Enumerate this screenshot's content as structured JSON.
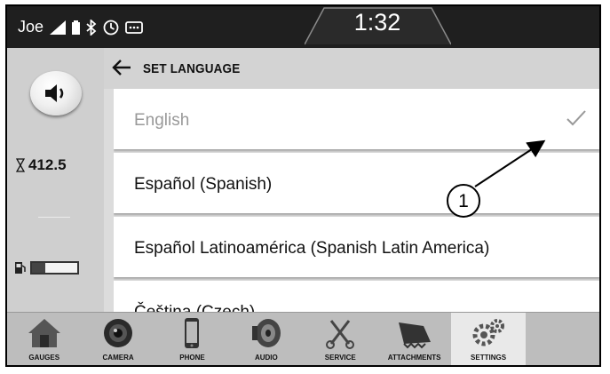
{
  "status_bar": {
    "carrier": "Joe",
    "time": "1:32"
  },
  "side_panel": {
    "hours": "412.5",
    "fuel_level": 0.3
  },
  "header": {
    "title": "SET LANGUAGE"
  },
  "languages": [
    {
      "label": "English",
      "selected": true
    },
    {
      "label": "Español (Spanish)",
      "selected": false
    },
    {
      "label": "Español Latinoamérica (Spanish Latin America)",
      "selected": false
    },
    {
      "label": "Čeština (Czech)",
      "selected": false
    }
  ],
  "callout": {
    "number": "1"
  },
  "bottom_nav": [
    {
      "label": "GAUGES",
      "icon": "house-icon"
    },
    {
      "label": "CAMERA",
      "icon": "camera-icon"
    },
    {
      "label": "PHONE",
      "icon": "phone-icon"
    },
    {
      "label": "AUDIO",
      "icon": "speaker-icon"
    },
    {
      "label": "SERVICE",
      "icon": "wrench-icon"
    },
    {
      "label": "ATTACHMENTS",
      "icon": "bucket-icon"
    },
    {
      "label": "SETTINGS",
      "icon": "gears-icon",
      "active": true
    }
  ]
}
